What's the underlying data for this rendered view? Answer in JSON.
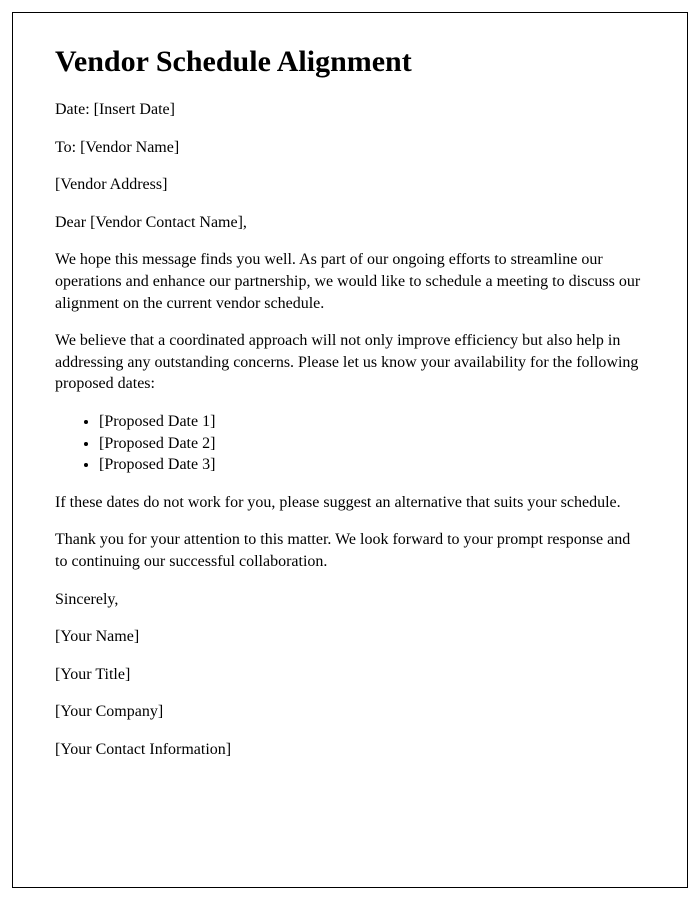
{
  "title": "Vendor Schedule Alignment",
  "date_line": "Date: [Insert Date]",
  "to_line": "To: [Vendor Name]",
  "address_line": "[Vendor Address]",
  "salutation": "Dear [Vendor Contact Name],",
  "body": {
    "para1": "We hope this message finds you well. As part of our ongoing efforts to streamline our operations and enhance our partnership, we would like to schedule a meeting to discuss our alignment on the current vendor schedule.",
    "para2": "We believe that a coordinated approach will not only improve efficiency but also help in addressing any outstanding concerns. Please let us know your availability for the following proposed dates:",
    "proposed_dates": [
      "[Proposed Date 1]",
      "[Proposed Date 2]",
      "[Proposed Date 3]"
    ],
    "para3": "If these dates do not work for you, please suggest an alternative that suits your schedule.",
    "para4": "Thank you for your attention to this matter. We look forward to your prompt response and to continuing our successful collaboration."
  },
  "closing": "Sincerely,",
  "signature": {
    "name": "[Your Name]",
    "title": "[Your Title]",
    "company": "[Your Company]",
    "contact": "[Your Contact Information]"
  }
}
